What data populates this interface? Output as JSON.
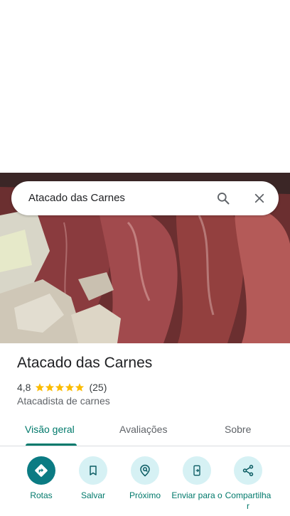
{
  "search": {
    "query": "Atacado das Carnes"
  },
  "place": {
    "name": "Atacado das Carnes",
    "rating": "4,8",
    "stars": 5,
    "review_count": "(25)",
    "category": "Atacadista de carnes"
  },
  "tabs": [
    {
      "label": "Visão geral",
      "active": true
    },
    {
      "label": "Avaliações",
      "active": false
    },
    {
      "label": "Sobre",
      "active": false
    }
  ],
  "actions": [
    {
      "label": "Rotas",
      "icon": "directions-icon"
    },
    {
      "label": "Salvar",
      "icon": "bookmark-icon"
    },
    {
      "label": "Próximo",
      "icon": "nearby-icon"
    },
    {
      "label": "Enviar para o",
      "icon": "send-to-phone-icon"
    },
    {
      "label": "Compartilha r",
      "icon": "share-icon"
    }
  ],
  "colors": {
    "accent": "#00796b",
    "primary_button": "#0b7b83",
    "action_bg": "#d6f1f4",
    "star": "#fbbc04"
  }
}
